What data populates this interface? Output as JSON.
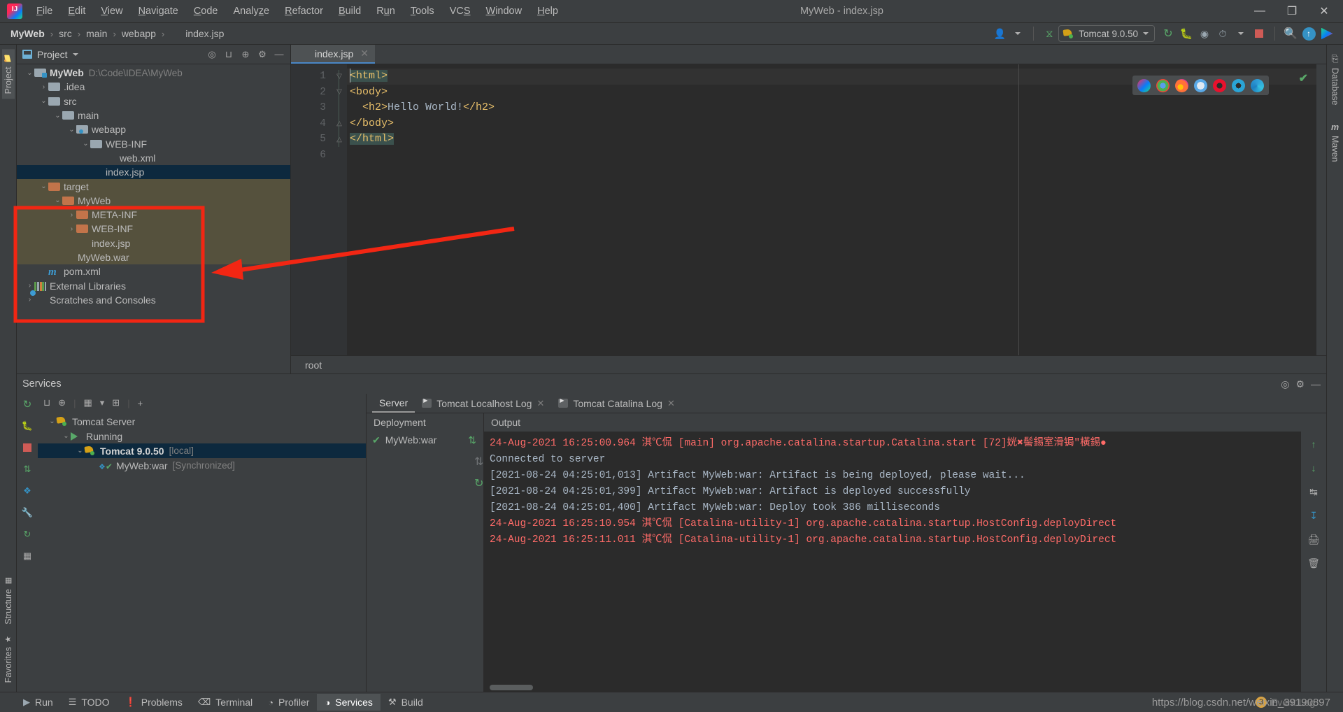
{
  "window": {
    "title": "MyWeb - index.jsp",
    "minimize": "—",
    "maximize": "❐",
    "close": "✕"
  },
  "menu": {
    "items": [
      "File",
      "Edit",
      "View",
      "Navigate",
      "Code",
      "Analyze",
      "Refactor",
      "Build",
      "Run",
      "Tools",
      "VCS",
      "Window",
      "Help"
    ]
  },
  "breadcrumb": {
    "items": [
      "MyWeb",
      "src",
      "main",
      "webapp",
      "index.jsp"
    ],
    "separator": "›"
  },
  "toolbar": {
    "run_config": "Tomcat 9.0.50",
    "icons": {
      "user": "user-icon",
      "hammer": "build-hammer-icon",
      "rerun": "rerun-icon",
      "debug": "debug-bug-icon",
      "run_with_coverage": "coverage-icon",
      "profile": "profile-icon",
      "stop": "stop-icon",
      "search": "search-icon",
      "update": "update-project-icon",
      "plugins": "plugins-icon"
    }
  },
  "left_rail": {
    "top": [
      "Project"
    ],
    "bottom": [
      "Structure",
      "Favorites"
    ]
  },
  "right_rail": {
    "items": [
      "Database",
      "Maven"
    ]
  },
  "project_panel": {
    "title": "Project",
    "header_icons": [
      "locate-icon",
      "expand-all-icon",
      "collapse-all-icon",
      "settings-gear-icon",
      "hide-icon"
    ],
    "tree": [
      {
        "indent": 0,
        "arrow": "⌄",
        "icon": "module-folder",
        "label": "MyWeb",
        "bold": true,
        "path": "D:\\Code\\IDEA\\MyWeb",
        "state": "normal"
      },
      {
        "indent": 1,
        "arrow": "›",
        "icon": "folder-gray",
        "label": ".idea",
        "bold": false,
        "path": "",
        "state": "normal"
      },
      {
        "indent": 1,
        "arrow": "⌄",
        "icon": "folder-gray",
        "label": "src",
        "bold": false,
        "path": "",
        "state": "normal"
      },
      {
        "indent": 2,
        "arrow": "⌄",
        "icon": "folder-gray",
        "label": "main",
        "bold": false,
        "path": "",
        "state": "normal"
      },
      {
        "indent": 3,
        "arrow": "⌄",
        "icon": "folder-source",
        "label": "webapp",
        "bold": false,
        "path": "",
        "state": "normal"
      },
      {
        "indent": 4,
        "arrow": "⌄",
        "icon": "folder-gray",
        "label": "WEB-INF",
        "bold": false,
        "path": "",
        "state": "normal"
      },
      {
        "indent": 5,
        "arrow": "",
        "icon": "xml-file",
        "label": "web.xml",
        "bold": false,
        "path": "",
        "state": "normal"
      },
      {
        "indent": 4,
        "arrow": "",
        "icon": "jsp-file",
        "label": "index.jsp",
        "bold": false,
        "path": "",
        "state": "selected"
      },
      {
        "indent": 1,
        "arrow": "⌄",
        "icon": "folder-orange",
        "label": "target",
        "bold": false,
        "path": "",
        "state": "target"
      },
      {
        "indent": 2,
        "arrow": "⌄",
        "icon": "folder-orange",
        "label": "MyWeb",
        "bold": false,
        "path": "",
        "state": "target"
      },
      {
        "indent": 3,
        "arrow": "›",
        "icon": "folder-orange",
        "label": "META-INF",
        "bold": false,
        "path": "",
        "state": "target"
      },
      {
        "indent": 3,
        "arrow": "›",
        "icon": "folder-orange",
        "label": "WEB-INF",
        "bold": false,
        "path": "",
        "state": "target"
      },
      {
        "indent": 3,
        "arrow": "",
        "icon": "jsp-file",
        "label": "index.jsp",
        "bold": false,
        "path": "",
        "state": "target"
      },
      {
        "indent": 2,
        "arrow": "",
        "icon": "war-file",
        "label": "MyWeb.war",
        "bold": false,
        "path": "",
        "state": "target"
      },
      {
        "indent": 1,
        "arrow": "",
        "icon": "maven-file",
        "label": "pom.xml",
        "bold": false,
        "path": "",
        "state": "normal"
      },
      {
        "indent": 0,
        "arrow": "›",
        "icon": "libraries",
        "label": "External Libraries",
        "bold": false,
        "path": "",
        "state": "normal"
      },
      {
        "indent": 0,
        "arrow": "›",
        "icon": "scratches",
        "label": "Scratches and Consoles",
        "bold": false,
        "path": "",
        "state": "normal"
      }
    ]
  },
  "editor": {
    "tab": {
      "label": "index.jsp",
      "icon": "jsp-file",
      "close": "✕"
    },
    "lines": [
      "1",
      "2",
      "3",
      "4",
      "5",
      "6"
    ],
    "code": [
      {
        "segments": [
          {
            "t": "<html>",
            "cls": "tk-tag hl-tag"
          }
        ],
        "current": true,
        "fold": "▽"
      },
      {
        "segments": [
          {
            "t": "<body>",
            "cls": "tk-tag"
          }
        ],
        "current": false,
        "fold": "▽"
      },
      {
        "segments": [
          {
            "t": "  <h2>",
            "cls": "tk-tag"
          },
          {
            "t": "Hello World!",
            "cls": "tk-txt"
          },
          {
            "t": "</h2>",
            "cls": "tk-tag"
          }
        ],
        "current": false,
        "fold": ""
      },
      {
        "segments": [
          {
            "t": "</body>",
            "cls": "tk-tag"
          }
        ],
        "current": false,
        "fold": "△"
      },
      {
        "segments": [
          {
            "t": "</html>",
            "cls": "tk-tag hl-tag"
          }
        ],
        "current": false,
        "fold": "△"
      },
      {
        "segments": [
          {
            "t": "",
            "cls": "tk-txt"
          }
        ],
        "current": false,
        "fold": ""
      }
    ],
    "browsers": [
      {
        "name": "intellij-browser-icon",
        "color": "#3b3b4f"
      },
      {
        "name": "chrome-browser-icon",
        "color": "#4caf50"
      },
      {
        "name": "firefox-browser-icon",
        "color": "#ff7139"
      },
      {
        "name": "safari-browser-icon",
        "color": "#5aa9e6"
      },
      {
        "name": "opera-browser-icon",
        "color": "#e8112d"
      },
      {
        "name": "internet-explorer-browser-icon",
        "color": "#2aa4d6"
      },
      {
        "name": "edge-browser-icon",
        "color": "#2e9bd6"
      }
    ],
    "status_text": "root",
    "inspection": "✔"
  },
  "services": {
    "title": "Services",
    "header_icons": [
      "locate-icon",
      "settings-gear-icon",
      "hide-icon"
    ],
    "left_rail": [
      "rerun-icon",
      "debug-icon",
      "stop-icon",
      "deploy-icon",
      "wrench-icon",
      "refresh-icon",
      "grid-icon"
    ],
    "toolbar_icons": [
      "expand-all-icon",
      "collapse-all-icon",
      "group-icon",
      "filter-icon",
      "add-frame-icon",
      "add-icon"
    ],
    "tree": [
      {
        "indent": 0,
        "arrow": "⌄",
        "icon": "tomcat-icon",
        "label": "Tomcat Server",
        "suffix": "",
        "bold": false,
        "selected": false
      },
      {
        "indent": 1,
        "arrow": "⌄",
        "icon": "running-icon",
        "label": "Running",
        "suffix": "",
        "bold": false,
        "selected": false
      },
      {
        "indent": 2,
        "arrow": "⌄",
        "icon": "tomcat-run-icon",
        "label": "Tomcat 9.0.50",
        "suffix": "[local]",
        "bold": true,
        "selected": true
      },
      {
        "indent": 3,
        "arrow": "",
        "icon": "artifact-ok-icon",
        "label": "MyWeb:war",
        "suffix": "[Synchronized]",
        "bold": false,
        "selected": false
      }
    ],
    "tabs": [
      {
        "label": "Server",
        "icon": "",
        "closable": false,
        "active": true
      },
      {
        "label": "Tomcat Localhost Log",
        "icon": "console-icon",
        "closable": true,
        "active": false
      },
      {
        "label": "Tomcat Catalina Log",
        "icon": "console-icon",
        "closable": true,
        "active": false
      }
    ],
    "deployment": {
      "header": "Deployment",
      "items": [
        {
          "label": "MyWeb:war",
          "status": "✔"
        }
      ],
      "side_icons": [
        "deploy-arrows-icon",
        "undeploy-icon",
        "redeploy-icon"
      ]
    },
    "output": {
      "header": "Output",
      "lines": [
        {
          "text": "24-Aug-2021 16:25:00.964 淇℃侃 [main] org.apache.catalina.startup.Catalina.start [72]姯✖髻錫室滑锔″橫錫●",
          "type": "error"
        },
        {
          "text": "Connected to server",
          "type": "info"
        },
        {
          "text": "[2021-08-24 04:25:01,013] Artifact MyWeb:war: Artifact is being deployed, please wait...",
          "type": "info"
        },
        {
          "text": "[2021-08-24 04:25:01,399] Artifact MyWeb:war: Artifact is deployed successfully",
          "type": "info"
        },
        {
          "text": "[2021-08-24 04:25:01,400] Artifact MyWeb:war: Deploy took 386 milliseconds",
          "type": "info"
        },
        {
          "text": "24-Aug-2021 16:25:10.954 淇℃侃 [Catalina-utility-1] org.apache.catalina.startup.HostConfig.deployDirect",
          "type": "error"
        },
        {
          "text": "24-Aug-2021 16:25:11.011 淇℃侃 [Catalina-utility-1] org.apache.catalina.startup.HostConfig.deployDirect",
          "type": "error"
        }
      ],
      "rail_icons": [
        "scroll-up-icon",
        "scroll-down-icon",
        "soft-wrap-icon",
        "scroll-to-end-icon",
        "print-icon",
        "clear-all-icon"
      ]
    }
  },
  "status_bar": {
    "buttons": [
      {
        "label": "Run",
        "icon": "run-icon",
        "active": false
      },
      {
        "label": "TODO",
        "icon": "todo-icon",
        "active": false
      },
      {
        "label": "Problems",
        "icon": "problems-icon",
        "active": false
      },
      {
        "label": "Terminal",
        "icon": "terminal-icon",
        "active": false
      },
      {
        "label": "Profiler",
        "icon": "profiler-icon",
        "active": false
      },
      {
        "label": "Services",
        "icon": "services-icon",
        "active": true
      },
      {
        "label": "Build",
        "icon": "build-icon",
        "active": false
      }
    ],
    "event_log": {
      "label": "Event Log",
      "badge": "3"
    },
    "watermark": "https://blog.csdn.net/weixin_39190897"
  },
  "colors": {
    "accent_blue": "#4a88c7",
    "selection_blue": "#0d293e",
    "target_highlight": "#55513d",
    "annotation_red": "#f22613",
    "error_red": "#ff6b68",
    "green": "#59a869",
    "bg": "#3c3f41",
    "editor_bg": "#2b2b2b"
  }
}
